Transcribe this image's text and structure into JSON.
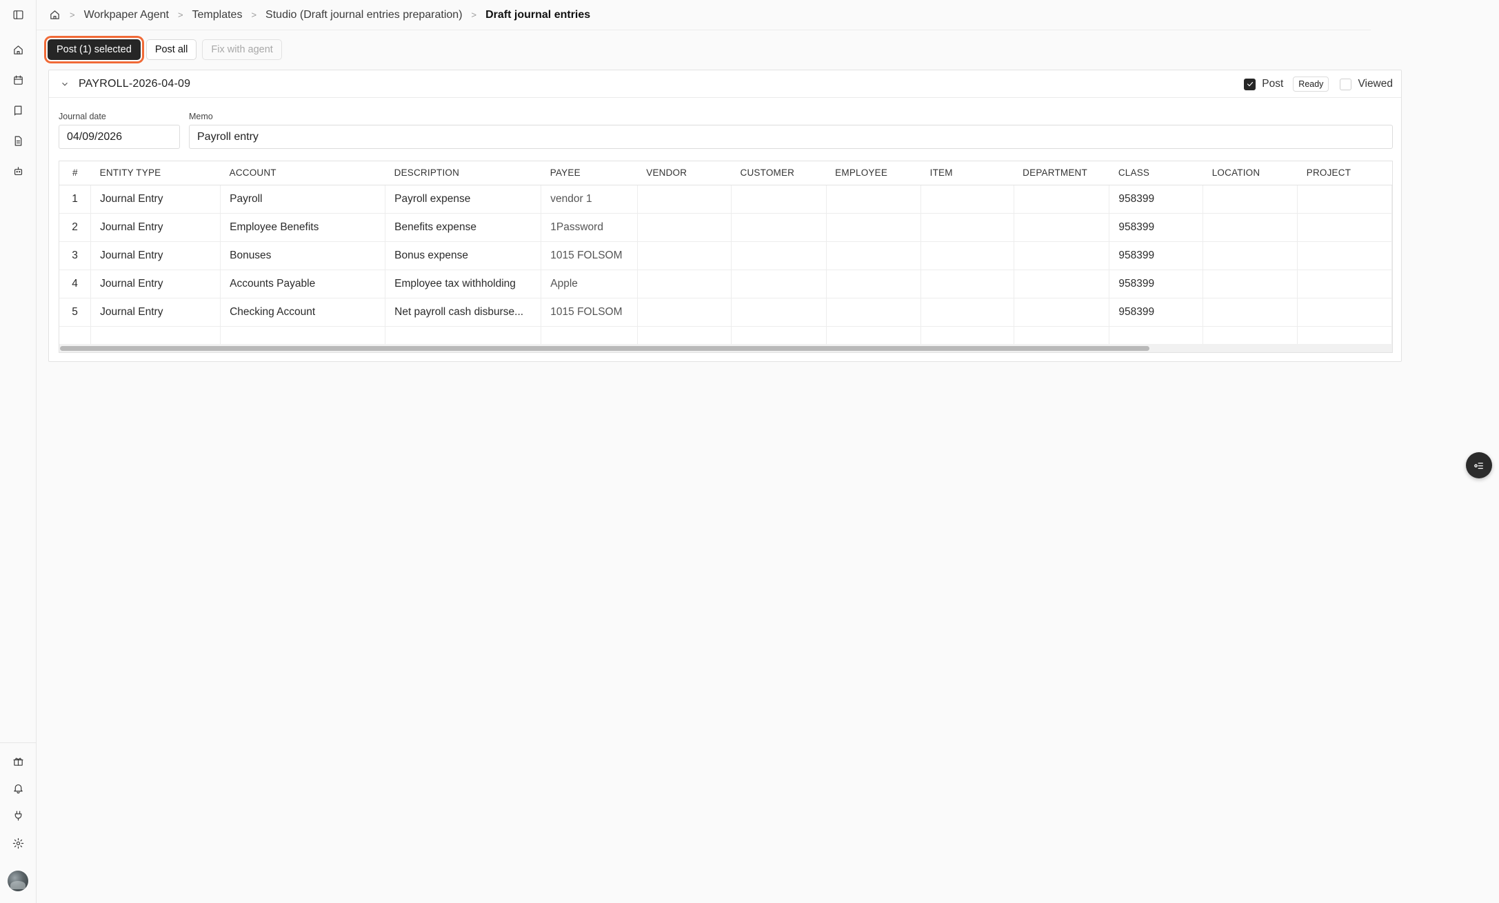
{
  "breadcrumb": [
    "Workpaper Agent",
    "Templates",
    "Studio (Draft journal entries preparation)",
    "Draft journal entries"
  ],
  "actions": {
    "post_selected": "Post (1) selected",
    "post_all": "Post all",
    "fix_with_agent": "Fix with agent"
  },
  "entry": {
    "title": "PAYROLL-2026-04-09",
    "post_label": "Post",
    "post_checked": true,
    "status": "Ready",
    "viewed_label": "Viewed",
    "viewed_checked": false,
    "journal_date_label": "Journal date",
    "journal_date": "04/09/2026",
    "memo_label": "Memo",
    "memo": "Payroll entry"
  },
  "table": {
    "columns": [
      "#",
      "ENTITY TYPE",
      "ACCOUNT",
      "DESCRIPTION",
      "PAYEE",
      "VENDOR",
      "CUSTOMER",
      "EMPLOYEE",
      "ITEM",
      "DEPARTMENT",
      "CLASS",
      "LOCATION",
      "PROJECT"
    ],
    "rows": [
      [
        "1",
        "Journal Entry",
        "Payroll",
        "Payroll expense",
        "vendor 1",
        "",
        "",
        "",
        "",
        "",
        "958399",
        "",
        ""
      ],
      [
        "2",
        "Journal Entry",
        "Employee Benefits",
        "Benefits expense",
        "1Password",
        "",
        "",
        "",
        "",
        "",
        "958399",
        "",
        ""
      ],
      [
        "3",
        "Journal Entry",
        "Bonuses",
        "Bonus expense",
        "1015 FOLSOM",
        "",
        "",
        "",
        "",
        "",
        "958399",
        "",
        ""
      ],
      [
        "4",
        "Journal Entry",
        "Accounts Payable",
        "Employee tax withholding",
        "Apple",
        "",
        "",
        "",
        "",
        "",
        "958399",
        "",
        ""
      ],
      [
        "5",
        "Journal Entry",
        "Checking Account",
        "Net payroll cash disburse...",
        "1015 FOLSOM",
        "",
        "",
        "",
        "",
        "",
        "958399",
        "",
        ""
      ]
    ]
  },
  "icons": {
    "rail_top": [
      "sidebar-toggle-icon",
      "home-icon",
      "calendar-icon",
      "book-icon",
      "document-icon",
      "bot-icon"
    ],
    "rail_bottom": [
      "gift-icon",
      "bell-icon",
      "plug-icon",
      "gear-icon"
    ],
    "fab": "task-list-icon"
  },
  "colors": {
    "primary_button": "#262626",
    "focus_ring": "#f06a37",
    "background": "#fafafa"
  }
}
